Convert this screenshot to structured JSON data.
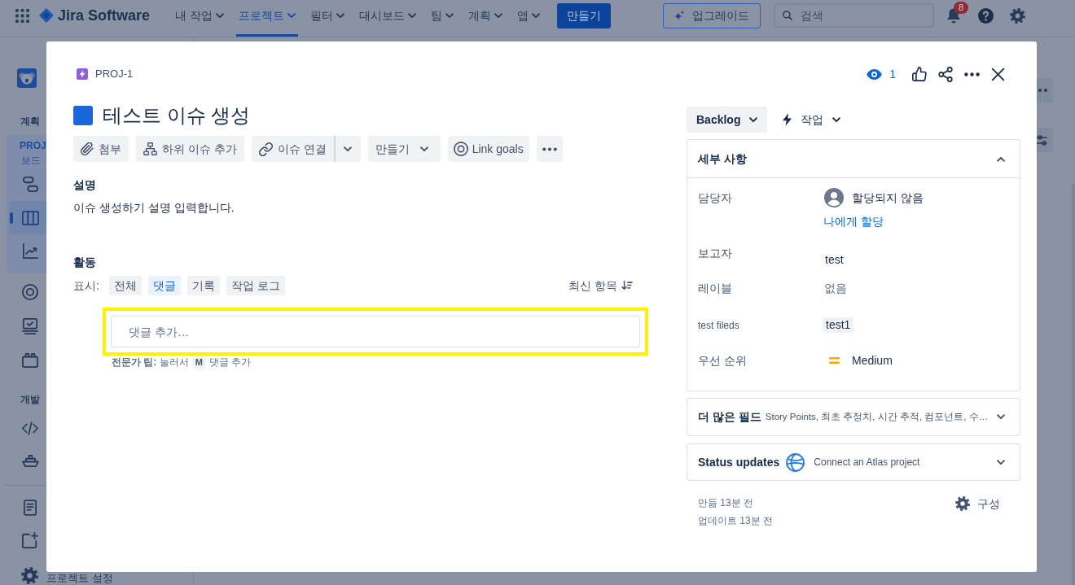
{
  "top_nav": {
    "product": "Jira Software",
    "menus": [
      {
        "label": "내 작업",
        "selected": false
      },
      {
        "label": "프로젝트",
        "selected": true
      },
      {
        "label": "필터",
        "selected": false
      },
      {
        "label": "대시보드",
        "selected": false
      },
      {
        "label": "팀",
        "selected": false
      },
      {
        "label": "계획",
        "selected": false
      },
      {
        "label": "앱",
        "selected": false
      }
    ],
    "create_button": "만들기",
    "upgrade_button": "업그레이드",
    "search": {
      "placeholder": "검색"
    },
    "notification_count": "8"
  },
  "sidebar": {
    "planning": {
      "heading": "계획",
      "project": {
        "name": "PROJ",
        "view": "보드",
        "items": [
          {
            "kind": "timeline",
            "selected": false
          },
          {
            "kind": "board",
            "selected": true
          },
          {
            "kind": "reports",
            "selected": false
          }
        ]
      },
      "items": [
        {
          "kind": "goals",
          "selected": false
        },
        {
          "kind": "checklist",
          "selected": false
        },
        {
          "kind": "calendar",
          "selected": false
        }
      ]
    },
    "development": {
      "heading": "개발",
      "items": [
        {
          "kind": "code",
          "selected": false
        },
        {
          "kind": "releases",
          "selected": false
        }
      ]
    },
    "shortcuts": [
      {
        "kind": "pages",
        "selected": false
      },
      {
        "kind": "add",
        "selected": false
      }
    ],
    "settings": {
      "label": "프로젝트 설정",
      "selected": false
    }
  },
  "issue": {
    "key": "PROJ-1",
    "title": "테스트 이슈 생성",
    "toolbar": [
      {
        "kind": "attach",
        "label": "첨부"
      },
      {
        "kind": "child_issue",
        "label": "하위 이슈 추가"
      },
      {
        "kind": "link_issue",
        "label": "이슈 연결"
      },
      {
        "kind": "create",
        "label": "만들기"
      },
      {
        "kind": "goals",
        "label": "Link goals"
      },
      {
        "kind": "more"
      }
    ],
    "description": {
      "heading": "설명",
      "text": "이슈 생성하기 설명 입력합니다."
    },
    "activity": {
      "heading": "활동",
      "filter_label": "표시:",
      "filters": [
        {
          "label": "전체",
          "selected": false
        },
        {
          "label": "댓글",
          "selected": true
        },
        {
          "label": "기록",
          "selected": false
        },
        {
          "label": "작업 로그",
          "selected": false
        }
      ],
      "sort": "최신 항목",
      "comment": {
        "placeholder": "댓글 추가…",
        "highlighted": true
      },
      "tip": {
        "text": "**전문가 팁:** 눌러서",
        "key": "M",
        "after": "댓글 추가"
      }
    },
    "watchers": {
      "count": "1",
      "watching": true
    },
    "status": "Backlog",
    "issue_type": "작업",
    "details": {
      "heading": "세부 사항",
      "expanded": true,
      "fields": [
        {
          "kind": "assignee",
          "label": "담당자",
          "value": "할당되지 않음",
          "action": "나에게 할당"
        },
        {
          "kind": "reporter",
          "label": "보고자",
          "value": "test"
        },
        {
          "kind": "labels",
          "label": "레이블",
          "value": "없음"
        },
        {
          "kind": "custom",
          "label": "test fileds",
          "value": "test1"
        },
        {
          "kind": "priority",
          "label": "우선 순위",
          "value": "Medium"
        }
      ]
    },
    "more_fields": {
      "heading": "더 많은 필드",
      "summary": "Story Points, 최초 추정치, 시간 추적, 컴포넌트, 수…",
      "expanded": false
    },
    "status_updates": {
      "heading": "Status updates",
      "text": "Connect an Atlas project",
      "expanded": false
    },
    "created": "만듦 13분 전",
    "updated": "업데이트 13분 전",
    "configure": "구성"
  }
}
